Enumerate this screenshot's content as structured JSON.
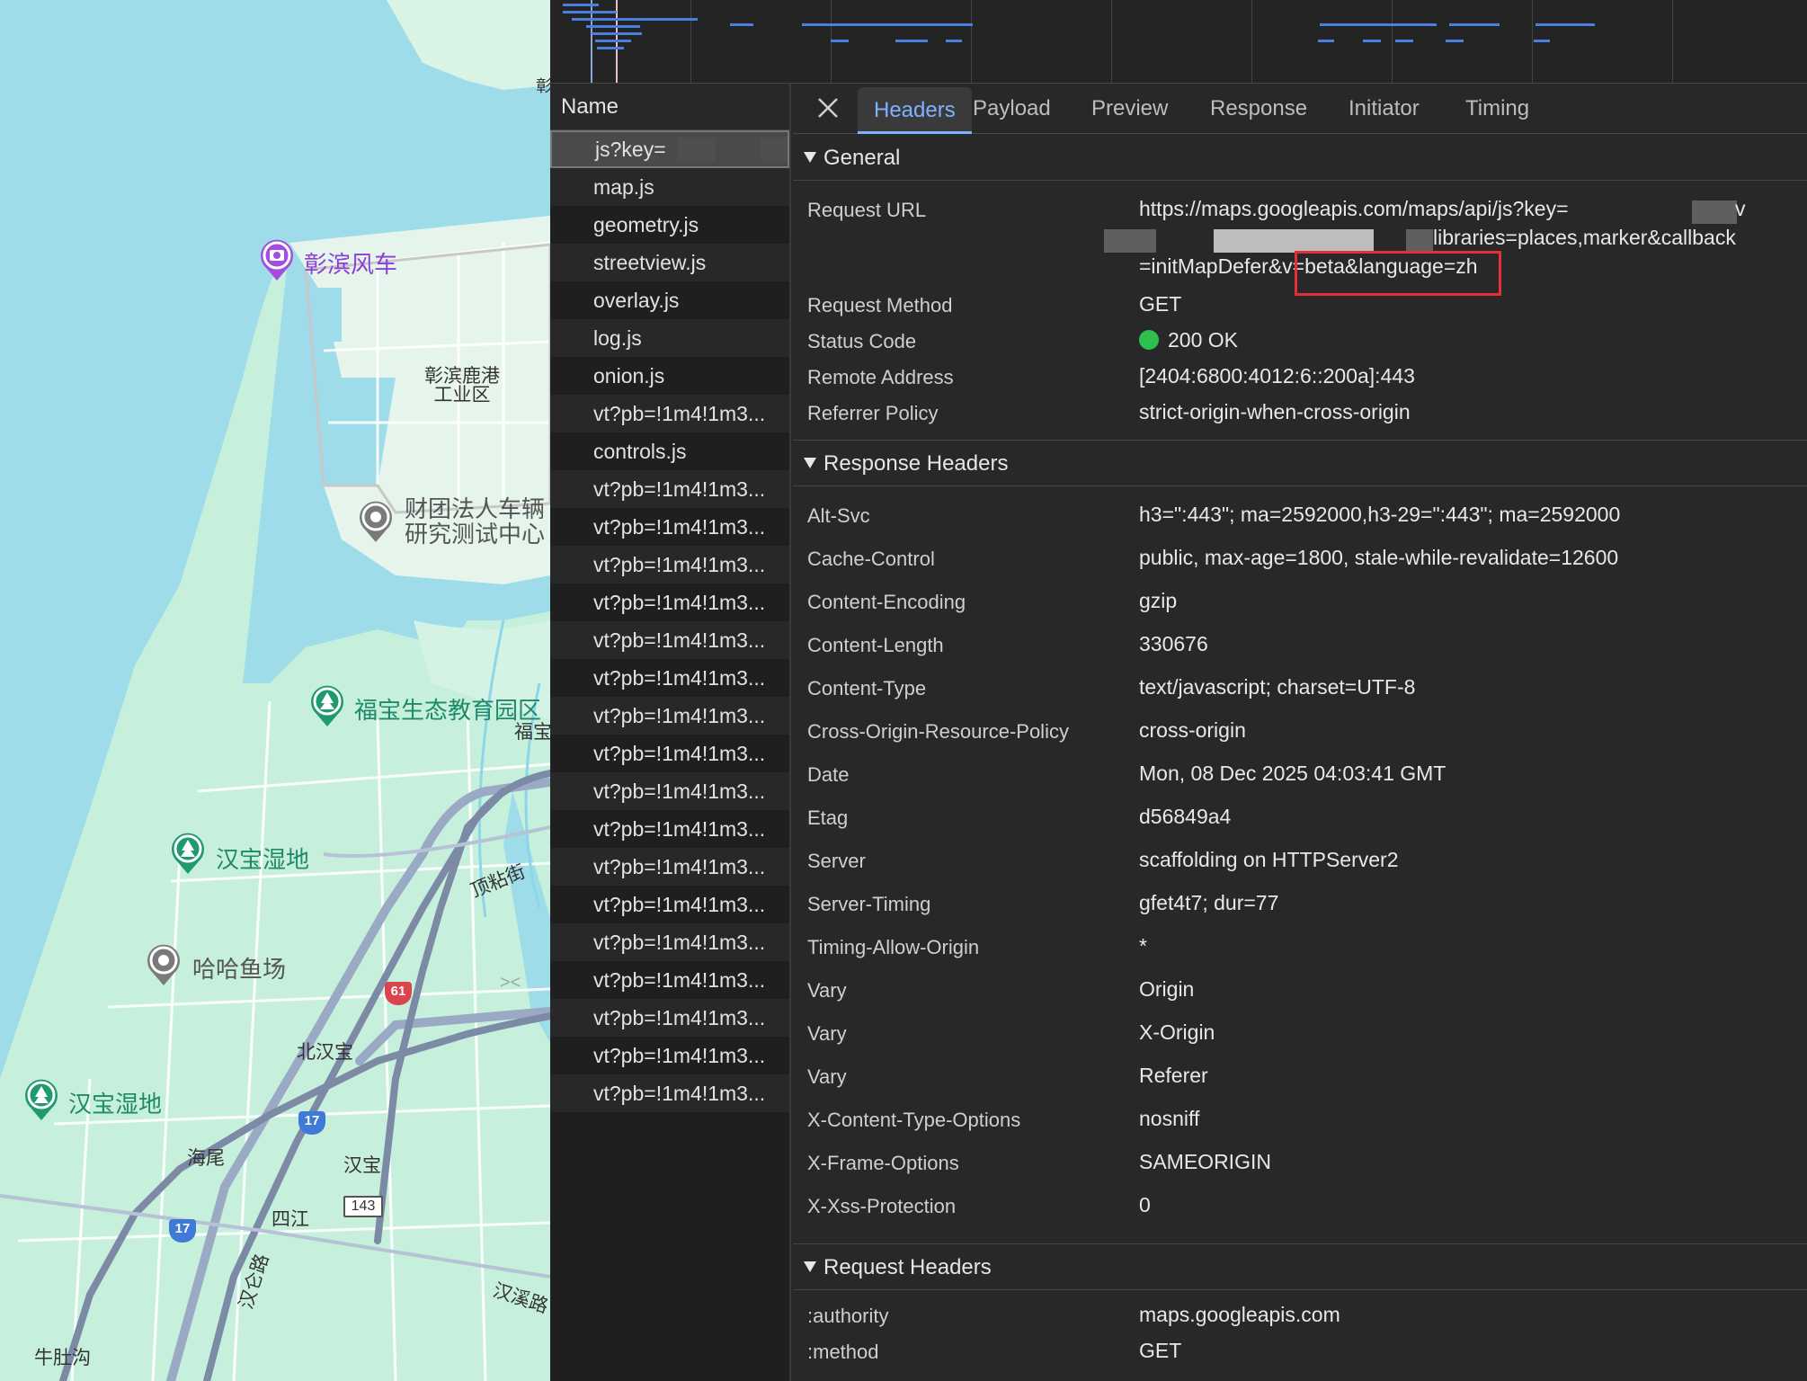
{
  "map": {
    "pois": [
      {
        "name": "彰滨风车",
        "style": "purple"
      },
      {
        "name": "财团法人车辆",
        "line2": "研究测试中心",
        "style": "gray"
      },
      {
        "name": "福宝生态教育园区",
        "style": "green"
      },
      {
        "name": "汉宝湿地",
        "style": "green"
      },
      {
        "name": "哈哈鱼场",
        "style": "gray"
      },
      {
        "name": "汉宝湿地",
        "style": "green"
      }
    ],
    "areas": {
      "industrial_1": "彰滨鹿港",
      "industrial_2": "工业区",
      "fubao": "福宝",
      "beihanbao": "北汉宝",
      "haiwei": "海尾",
      "hanbao": "汉宝",
      "sijiang": "四江",
      "niudugou": "牛肚沟",
      "zhang": "彰"
    },
    "roads": {
      "dingnian": "顶粘街",
      "hanlun": "汉仑路",
      "hanxi": "汉溪路"
    },
    "shields": {
      "r61": "61",
      "r17a": "17",
      "r17b": "17",
      "r143": "143"
    }
  },
  "devtools": {
    "name_header": "Name",
    "requests": [
      "js?key=",
      "map.js",
      "geometry.js",
      "streetview.js",
      "overlay.js",
      "log.js",
      "onion.js",
      "vt?pb=!1m4!1m3...",
      "controls.js",
      "vt?pb=!1m4!1m3...",
      "vt?pb=!1m4!1m3...",
      "vt?pb=!1m4!1m3...",
      "vt?pb=!1m4!1m3...",
      "vt?pb=!1m4!1m3...",
      "vt?pb=!1m4!1m3...",
      "vt?pb=!1m4!1m3...",
      "vt?pb=!1m4!1m3...",
      "vt?pb=!1m4!1m3...",
      "vt?pb=!1m4!1m3...",
      "vt?pb=!1m4!1m3...",
      "vt?pb=!1m4!1m3...",
      "vt?pb=!1m4!1m3...",
      "vt?pb=!1m4!1m3...",
      "vt?pb=!1m4!1m3...",
      "vt?pb=!1m4!1m3...",
      "vt?pb=!1m4!1m3..."
    ],
    "tabs": [
      "Headers",
      "Payload",
      "Preview",
      "Response",
      "Initiator",
      "Timing"
    ],
    "general": {
      "title": "General",
      "request_url_label": "Request URL",
      "request_url_line1": "https://maps.googleapis.com/maps/api/js?key=",
      "request_url_line2": "libraries=places,marker&callback",
      "request_url_line3": "=initMapDefer&v=beta&language=zh",
      "request_method_label": "Request Method",
      "request_method": "GET",
      "status_code_label": "Status Code",
      "status_code": "200 OK",
      "remote_address_label": "Remote Address",
      "remote_address": "[2404:6800:4012:6::200a]:443",
      "referrer_policy_label": "Referrer Policy",
      "referrer_policy": "strict-origin-when-cross-origin"
    },
    "response_headers": {
      "title": "Response Headers",
      "rows": [
        {
          "name": "Alt-Svc",
          "value": "h3=\":443\"; ma=2592000,h3-29=\":443\"; ma=2592000"
        },
        {
          "name": "Cache-Control",
          "value": "public, max-age=1800, stale-while-revalidate=12600"
        },
        {
          "name": "Content-Encoding",
          "value": "gzip"
        },
        {
          "name": "Content-Length",
          "value": "330676"
        },
        {
          "name": "Content-Type",
          "value": "text/javascript; charset=UTF-8"
        },
        {
          "name": "Cross-Origin-Resource-Policy",
          "value": "cross-origin"
        },
        {
          "name": "Date",
          "value": "Mon, 08 Dec 2025 04:03:41 GMT"
        },
        {
          "name": "Etag",
          "value": "d56849a4"
        },
        {
          "name": "Server",
          "value": "scaffolding on HTTPServer2"
        },
        {
          "name": "Server-Timing",
          "value": "gfet4t7; dur=77"
        },
        {
          "name": "Timing-Allow-Origin",
          "value": "*"
        },
        {
          "name": "Vary",
          "value": "Origin"
        },
        {
          "name": "Vary",
          "value": "X-Origin"
        },
        {
          "name": "Vary",
          "value": "Referer"
        },
        {
          "name": "X-Content-Type-Options",
          "value": "nosniff"
        },
        {
          "name": "X-Frame-Options",
          "value": "SAMEORIGIN"
        },
        {
          "name": "X-Xss-Protection",
          "value": "0"
        }
      ]
    },
    "request_headers": {
      "title": "Request Headers",
      "rows": [
        {
          "name": ":authority",
          "value": "maps.googleapis.com"
        },
        {
          "name": ":method",
          "value": "GET"
        }
      ]
    },
    "colors": {
      "accent": "#7eb2ff",
      "status_ok": "#2fbf4f",
      "highlight": "#e0303a"
    }
  }
}
